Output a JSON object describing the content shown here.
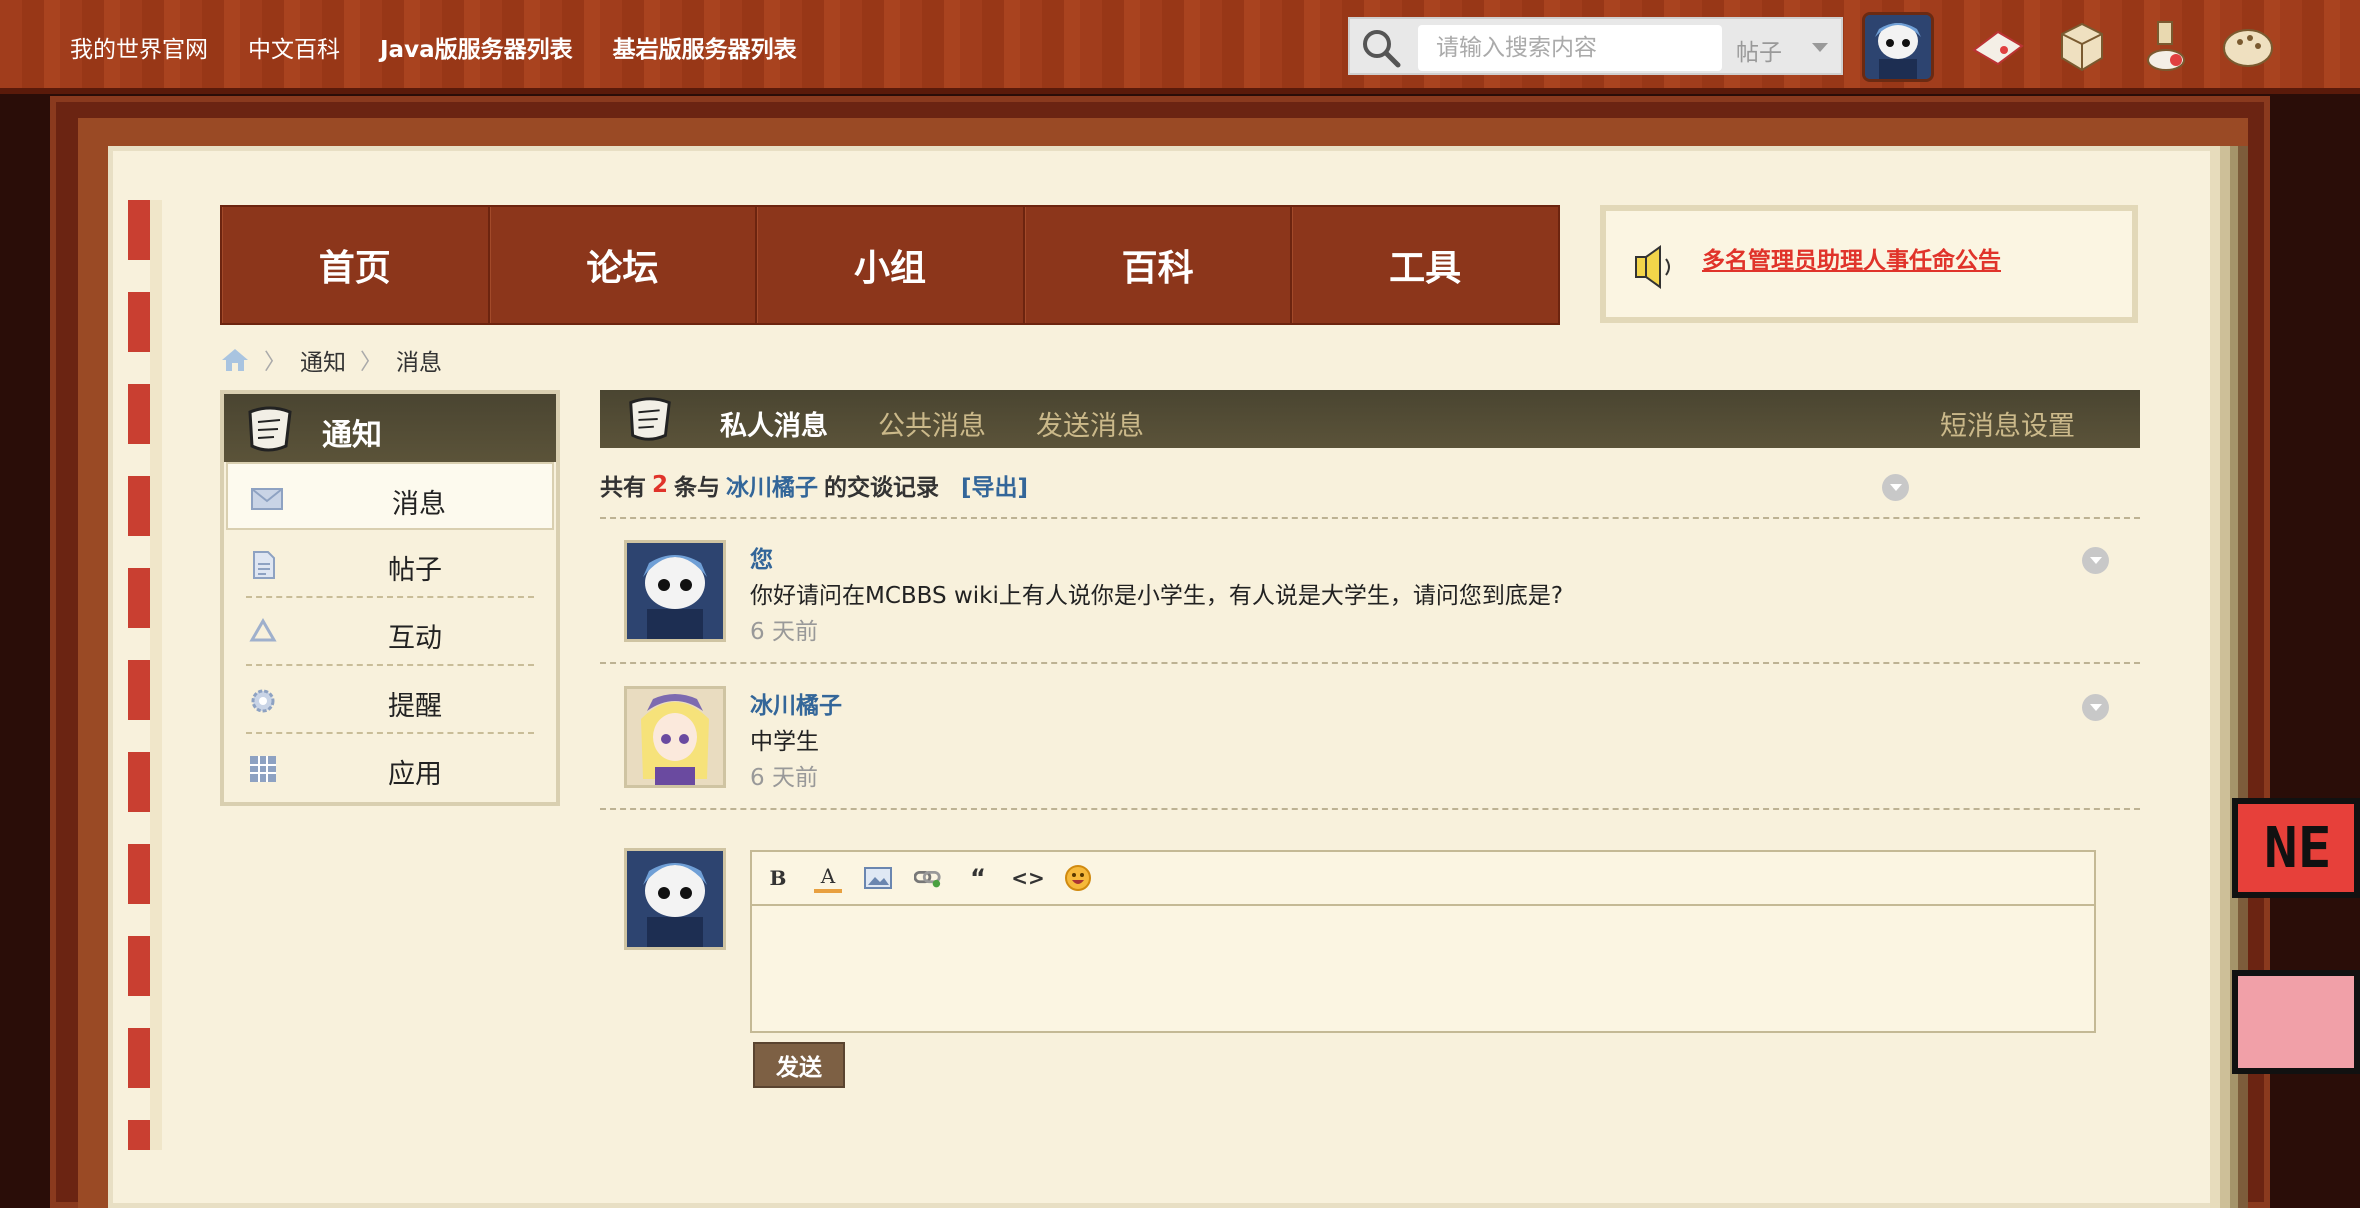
{
  "topbar": {
    "links": [
      "我的世界官网",
      "中文百科",
      "Java版服务器列表",
      "基岩版服务器列表"
    ],
    "search": {
      "placeholder": "请输入搜索内容",
      "scope": "帖子"
    }
  },
  "nav": {
    "items": [
      "首页",
      "论坛",
      "小组",
      "百科",
      "工具"
    ]
  },
  "announcement": "多名管理员助理人事任命公告",
  "breadcrumb": [
    "通知",
    "消息"
  ],
  "sidebar": {
    "title": "通知",
    "items": [
      {
        "label": "消息",
        "icon": "envelope-icon"
      },
      {
        "label": "帖子",
        "icon": "document-icon"
      },
      {
        "label": "互动",
        "icon": "recycle-icon"
      },
      {
        "label": "提醒",
        "icon": "gear-icon"
      },
      {
        "label": "应用",
        "icon": "grid-icon"
      }
    ]
  },
  "tabs": {
    "private": "私人消息",
    "public": "公共消息",
    "send": "发送消息",
    "settings": "短消息设置"
  },
  "summary": {
    "prefix": "共有",
    "count": "2",
    "mid": "条与",
    "user": "冰川橘子",
    "suffix": "的交谈记录",
    "export": "[导出]"
  },
  "messages": [
    {
      "author": "您",
      "body": "你好请问在MCBBS wiki上有人说你是小学生，有人说是大学生，请问您到底是?",
      "time": "6 天前"
    },
    {
      "author": "冰川橘子",
      "body": "中学生",
      "time": "6 天前"
    }
  ],
  "reply": {
    "send": "发送"
  },
  "colors": {
    "topbar": "#a13d1c",
    "nav": "#8c361b",
    "accent_link": "#336699",
    "alert": "#e0332a"
  }
}
